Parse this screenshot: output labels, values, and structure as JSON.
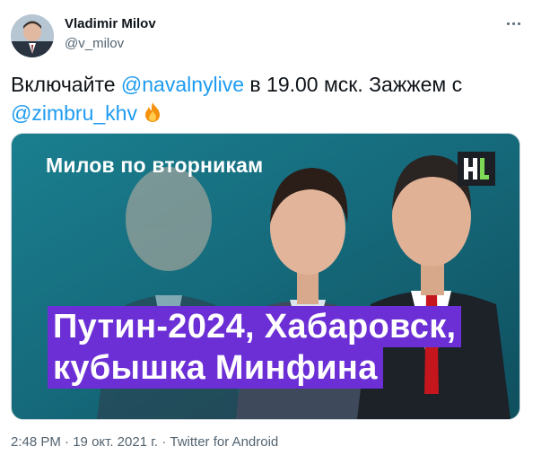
{
  "author": {
    "name": "Vladimir Milov",
    "handle": "@v_milov"
  },
  "tweet": {
    "text_1": "Включайте ",
    "mention_1": "@navalnylive",
    "text_2": " в 19.00 мск. Зажжем с ",
    "mention_2": "@zimbru_khv",
    "emoji": "fire-emoji"
  },
  "media": {
    "subtitle": "Милов по вторникам",
    "headline_line1": "Путин-2024, Хабаровск,",
    "headline_line2": "кубышка Минфина",
    "logo_text": "HL"
  },
  "meta": {
    "time": "2:48 PM",
    "date": "19 окт. 2021 г.",
    "source": "Twitter for Android",
    "separator": " · "
  },
  "colors": {
    "accent": "#1d9bf0",
    "headline_bg": "#6c2fd6",
    "media_bg": "#1b7f8e"
  }
}
